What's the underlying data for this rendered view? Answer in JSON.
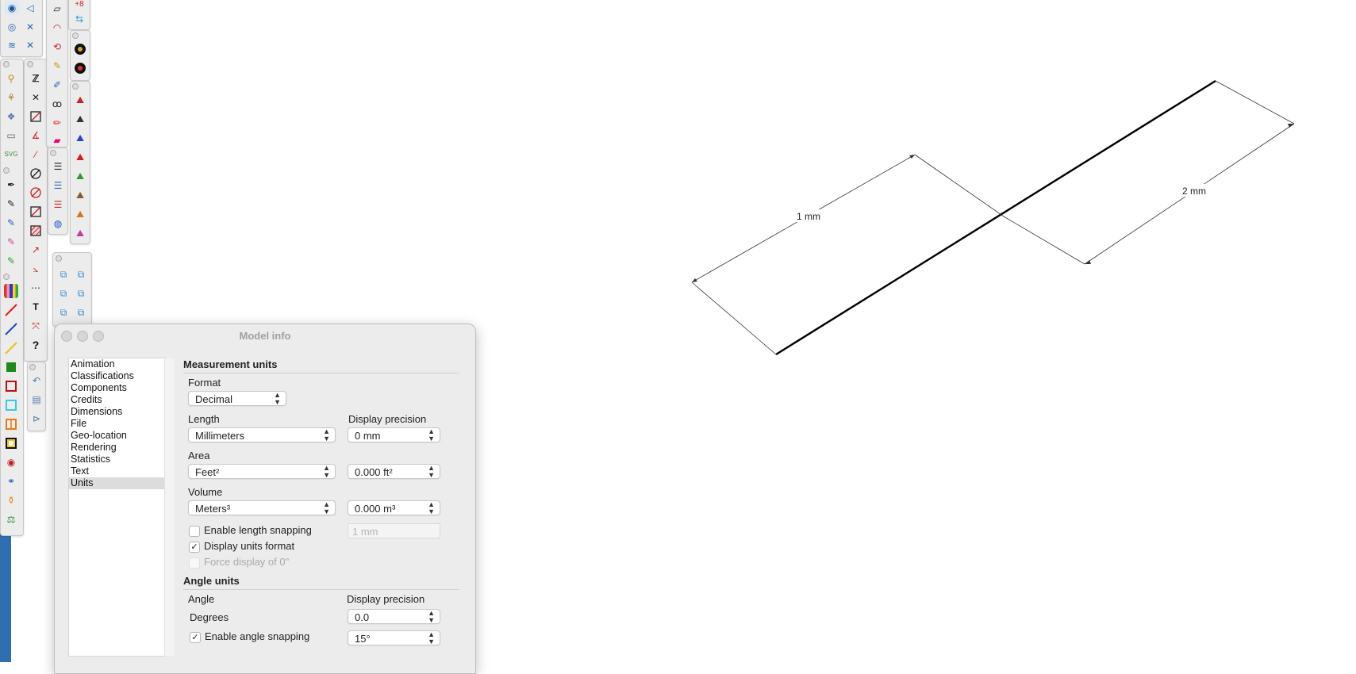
{
  "drawing": {
    "dim1_label": "1 mm",
    "dim2_label": "2 mm"
  },
  "window": {
    "title": "Model info",
    "sidebar": [
      {
        "label": "Animation"
      },
      {
        "label": "Classifications"
      },
      {
        "label": "Components"
      },
      {
        "label": "Credits"
      },
      {
        "label": "Dimensions"
      },
      {
        "label": "File"
      },
      {
        "label": "Geo-location"
      },
      {
        "label": "Rendering"
      },
      {
        "label": "Statistics"
      },
      {
        "label": "Text"
      },
      {
        "label": "Units",
        "selected": true
      }
    ],
    "measurement": {
      "heading": "Measurement units",
      "format_label": "Format",
      "format_value": "Decimal",
      "length_label": "Length",
      "length_value": "Millimeters",
      "display_precision_label": "Display precision",
      "length_precision": "0 mm",
      "area_label": "Area",
      "area_value": "Feet²",
      "area_precision": "0.000 ft²",
      "volume_label": "Volume",
      "volume_value": "Meters³",
      "volume_precision": "0.000 m³",
      "length_snapping_label": "Enable length snapping",
      "length_snapping_checked": false,
      "length_snapping_value": "1 mm",
      "display_units_label": "Display units format",
      "display_units_checked": true,
      "force_zero_label": "Force display of 0\"",
      "force_zero_checked": false
    },
    "angle": {
      "heading": "Angle units",
      "angle_label": "Angle",
      "display_precision_label": "Display precision",
      "unit_value": "Degrees",
      "precision": "0.0",
      "snapping_label": "Enable angle snapping",
      "snapping_checked": true,
      "snapping_value": "15°"
    },
    "check_glyph": "✓"
  },
  "colors": {
    "toolbar_bg": "#ececec",
    "strip": "#2f6fb0",
    "selection": "#dcdcdc"
  }
}
